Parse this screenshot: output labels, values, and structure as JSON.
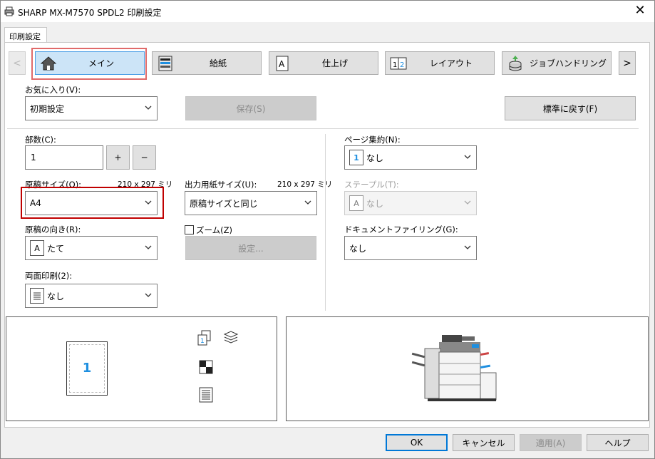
{
  "window": {
    "title": "SHARP MX-M7570 SPDL2 印刷設定",
    "close_glyph": "✕"
  },
  "tab": {
    "label": "印刷設定"
  },
  "nav": {
    "prev_glyph": "<",
    "next_glyph": ">",
    "items": [
      {
        "label": "メイン",
        "icon": "home-icon",
        "selected": true
      },
      {
        "label": "給紙",
        "icon": "paper-tray-icon"
      },
      {
        "label": "仕上げ",
        "icon": "finishing-icon"
      },
      {
        "label": "レイアウト",
        "icon": "layout-icon"
      },
      {
        "label": "ジョブハンドリング",
        "icon": "job-handling-icon"
      }
    ]
  },
  "favorites": {
    "label": "お気に入り(V):",
    "value": "初期設定",
    "save_label": "保存(S)",
    "reset_label": "標準に戻す(F)"
  },
  "copies": {
    "label": "部数(C):",
    "value": "1",
    "plus": "+",
    "minus": "−"
  },
  "original_size": {
    "label": "原稿サイズ(O):",
    "dims": "210 x 297 ミリ",
    "value": "A4"
  },
  "output_size": {
    "label": "出力用紙サイズ(U):",
    "dims": "210 x 297 ミリ",
    "value": "原稿サイズと同じ"
  },
  "orientation": {
    "label": "原稿の向き(R):",
    "icon_glyph": "A",
    "value": "たて"
  },
  "zoom": {
    "label": "ズーム(Z)",
    "checked": false,
    "settings_label": "設定..."
  },
  "duplex": {
    "label": "両面印刷(2):",
    "value": "なし"
  },
  "n_up": {
    "label": "ページ集約(N):",
    "icon_glyph": "1",
    "value": "なし"
  },
  "staple": {
    "label": "ステープル(T):",
    "icon_glyph": "A",
    "value": "なし"
  },
  "document_filing": {
    "label": "ドキュメントファイリング(G):",
    "value": "なし"
  },
  "preview": {
    "page_number": "1"
  },
  "buttons": {
    "ok": "OK",
    "cancel": "キャンセル",
    "apply": "適用(A)",
    "help": "ヘルプ"
  },
  "colors": {
    "accent": "#0078d7",
    "selected_tab_bg": "#cce4f7",
    "highlight_red": "#c00000",
    "highlight_pink": "#e06a6a",
    "preview_number": "#1e8fe0"
  }
}
